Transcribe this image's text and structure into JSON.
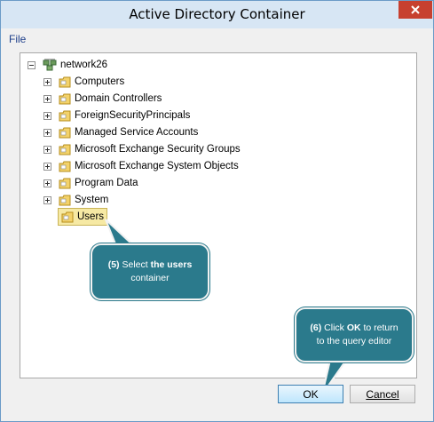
{
  "window": {
    "title": "Active Directory Container"
  },
  "menu": {
    "file": "File"
  },
  "tree": {
    "root": "network26",
    "children": [
      "Computers",
      "Domain Controllers",
      "ForeignSecurityPrincipals",
      "Managed Service Accounts",
      "Microsoft Exchange Security Groups",
      "Microsoft Exchange System Objects",
      "Program Data",
      "System",
      "Users"
    ],
    "selected": "Users"
  },
  "callouts": {
    "step5": {
      "num": "(5)",
      "pre": "Select ",
      "bold": "the users",
      "post": "container"
    },
    "step6": {
      "num": "(6)",
      "pre": "Click ",
      "bold": "OK",
      "post1": " to return",
      "post2": "to the query editor"
    }
  },
  "buttons": {
    "ok": "OK",
    "cancel": "Cancel"
  },
  "colors": {
    "callout": "#2b7a8c",
    "close": "#c7402f",
    "selection": "#f6e9a4",
    "title_bar": "#d7e6f4"
  }
}
